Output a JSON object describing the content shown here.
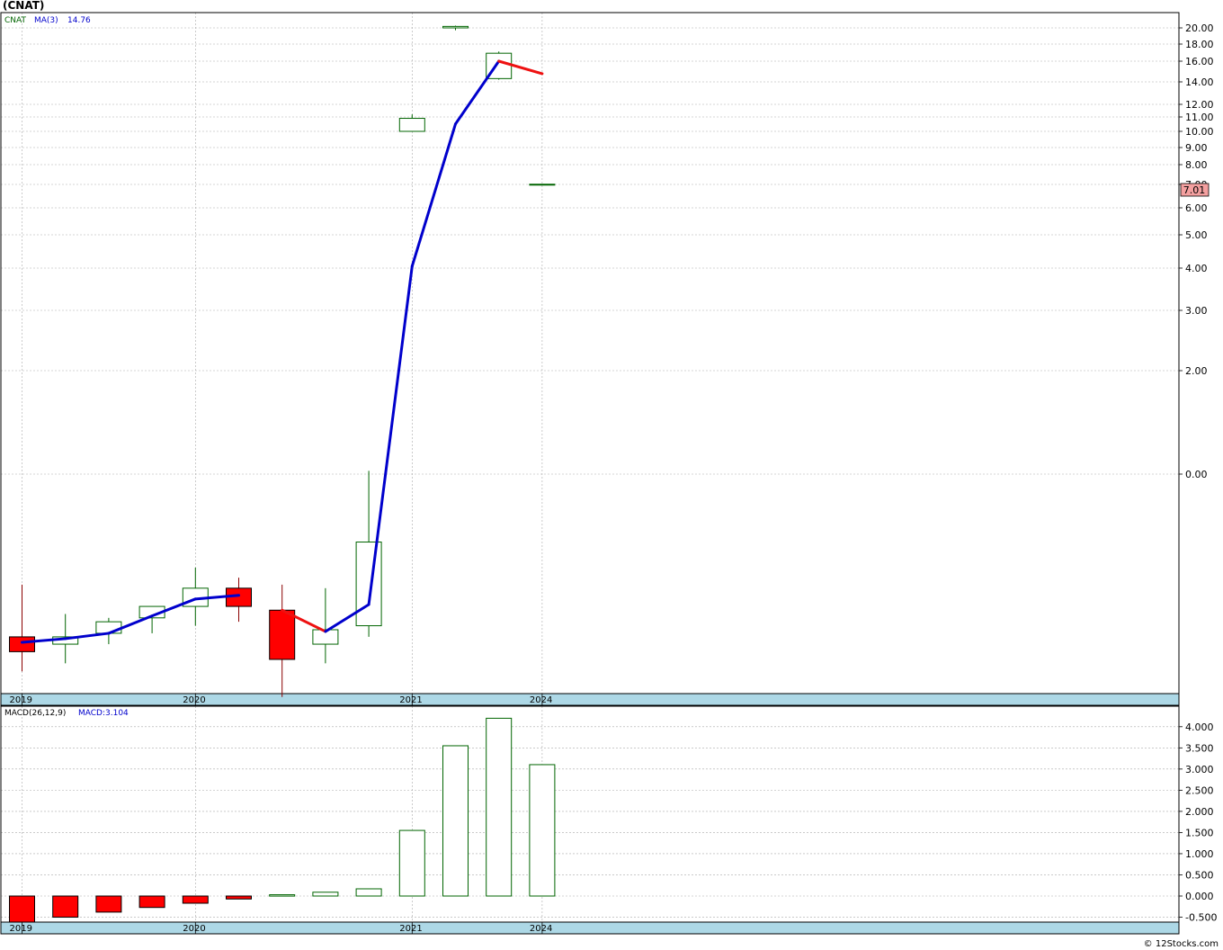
{
  "header": {
    "title": "(CNAT)",
    "ticker": "CNAT",
    "ma_label": "MA(3)",
    "ma_value": "14.76",
    "macd_label": "MACD(26,12,9)",
    "macd_value": "MACD:3.104",
    "watermark": "© 12Stocks.com"
  },
  "colors": {
    "up_outline": "#006400",
    "down_fill": "#ff0000",
    "ma_up": "#0000cc",
    "ma_down": "#ee1111",
    "axis_band": "#add8e6",
    "price_badge": "#f4a0a0"
  },
  "chart_data": [
    {
      "type": "candlestick",
      "title": "(CNAT)",
      "price_badge": "7.01",
      "y_ticks": [
        "0.00",
        "2.00",
        "3.00",
        "4.00",
        "5.00",
        "6.00",
        "7.00",
        "8.00",
        "9.00",
        "10.00",
        "11.00",
        "12.00",
        "14.00",
        "16.00",
        "18.00",
        "20.00"
      ],
      "x_labels": [
        {
          "label": "2019",
          "index": 0
        },
        {
          "label": "2020",
          "index": 4
        },
        {
          "label": "2021",
          "index": 9
        },
        {
          "label": "2024",
          "index": 12
        }
      ],
      "candles": [
        {
          "open": 0.78,
          "high": 0.92,
          "low": 0.69,
          "close": 0.74
        },
        {
          "open": 0.76,
          "high": 0.84,
          "low": 0.71,
          "close": 0.78
        },
        {
          "open": 0.79,
          "high": 0.83,
          "low": 0.76,
          "close": 0.82
        },
        {
          "open": 0.83,
          "high": 0.86,
          "low": 0.79,
          "close": 0.86
        },
        {
          "open": 0.86,
          "high": 0.97,
          "low": 0.81,
          "close": 0.91
        },
        {
          "open": 0.91,
          "high": 0.94,
          "low": 0.82,
          "close": 0.86
        },
        {
          "open": 0.85,
          "high": 0.92,
          "low": 0.63,
          "close": 0.72
        },
        {
          "open": 0.76,
          "high": 0.91,
          "low": 0.71,
          "close": 0.8
        },
        {
          "open": 0.81,
          "high": 1.38,
          "low": 0.78,
          "close": 1.06
        },
        {
          "open": 10.0,
          "high": 11.2,
          "low": 10.0,
          "close": 10.9
        },
        {
          "open": 20.0,
          "high": 20.3,
          "low": 19.7,
          "close": 20.2
        },
        {
          "open": 14.3,
          "high": 17.1,
          "low": 14.2,
          "close": 16.9
        },
        {
          "open": 7.01,
          "high": 7.01,
          "low": 7.01,
          "close": 7.01
        }
      ],
      "ma": [
        0.765,
        0.775,
        0.79,
        0.835,
        0.88,
        0.89,
        0.85,
        0.795,
        0.865,
        4.05,
        10.5,
        16.0,
        14.76
      ]
    },
    {
      "type": "bar",
      "title": "MACD(26,12,9)",
      "y_ticks": [
        "-0.500",
        "0.000",
        "0.500",
        "1.000",
        "1.500",
        "2.000",
        "2.500",
        "3.000",
        "3.500",
        "4.000"
      ],
      "ylim": [
        -0.62,
        4.3
      ],
      "values": [
        -0.64,
        -0.5,
        -0.38,
        -0.27,
        -0.17,
        -0.07,
        0.03,
        0.09,
        0.17,
        1.55,
        3.55,
        4.2,
        3.104
      ],
      "x_labels": [
        {
          "label": "2019",
          "index": 0
        },
        {
          "label": "2020",
          "index": 4
        },
        {
          "label": "2021",
          "index": 9
        },
        {
          "label": "2024",
          "index": 12
        }
      ]
    }
  ]
}
